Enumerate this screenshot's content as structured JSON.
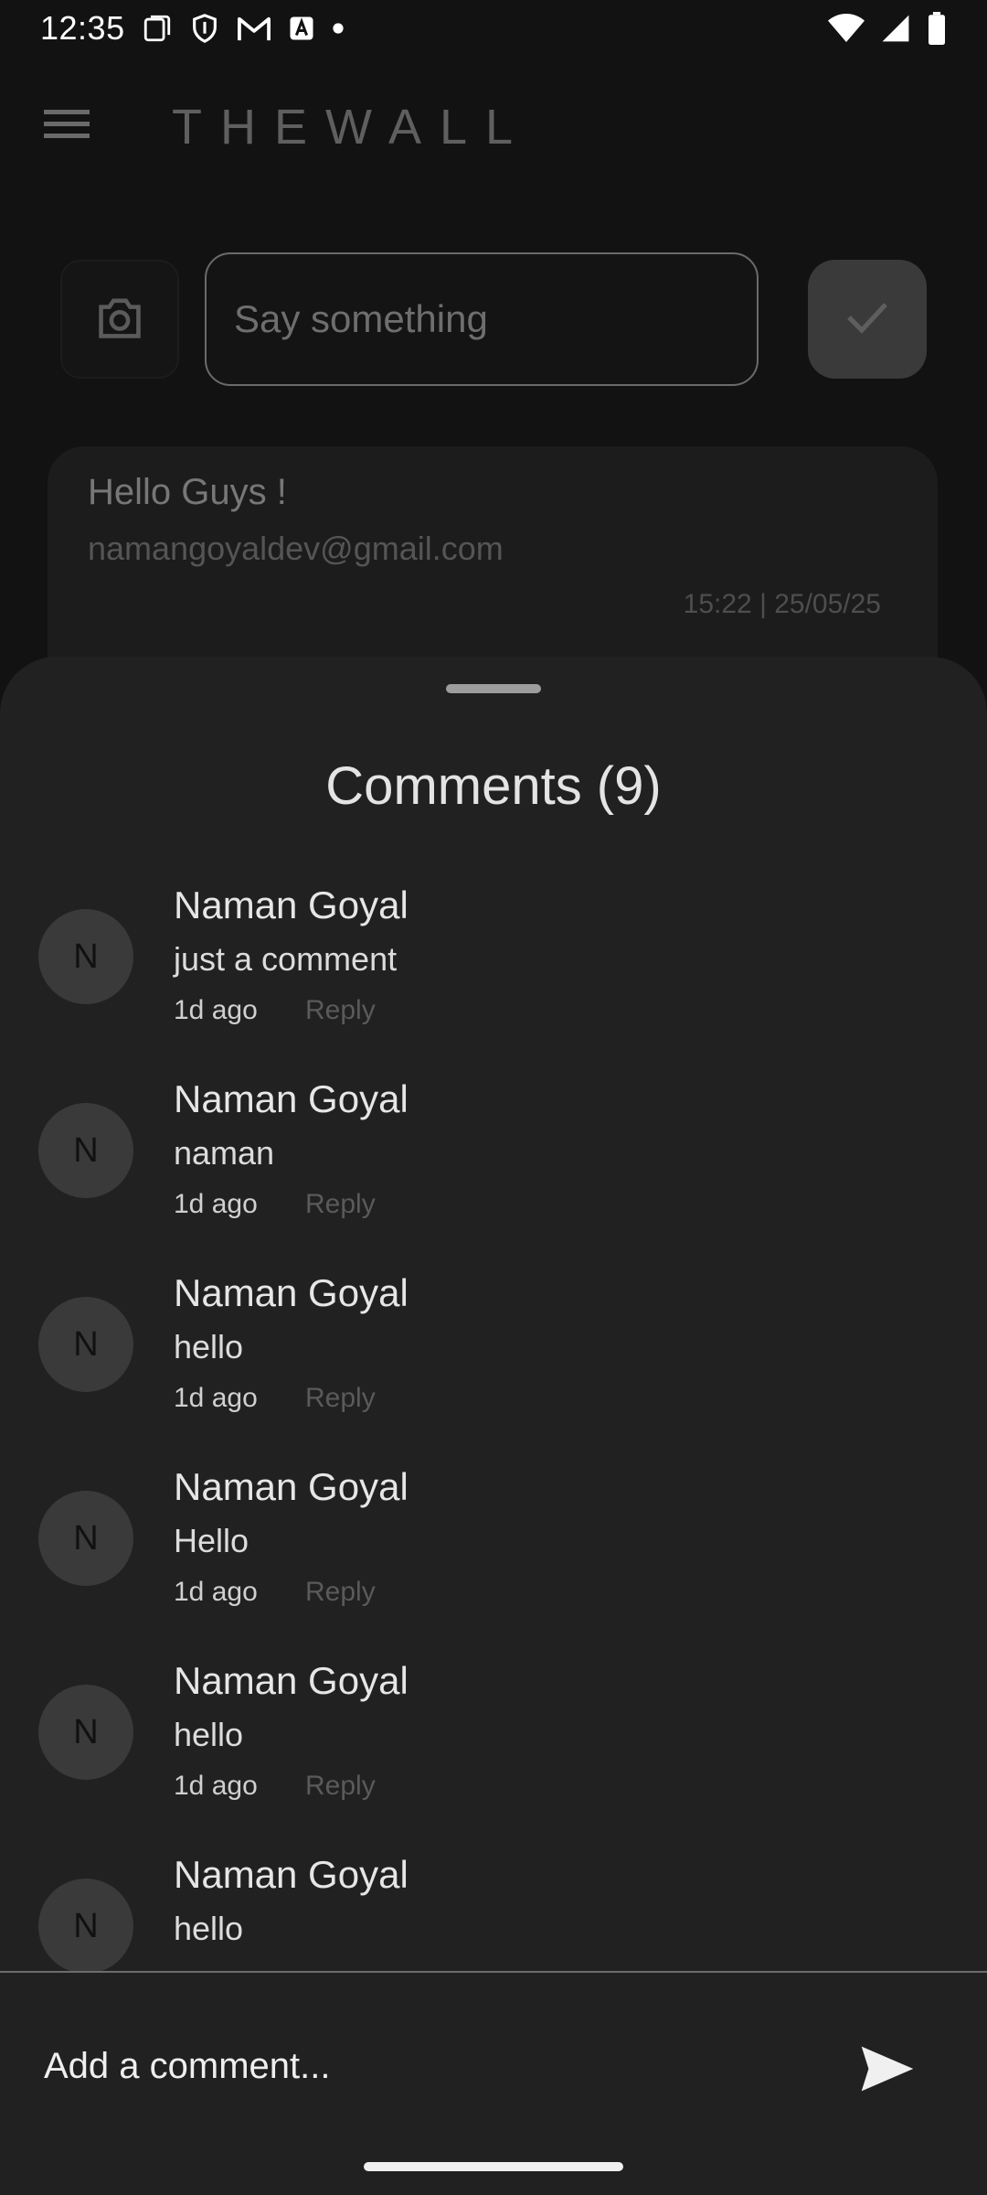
{
  "status_bar": {
    "time": "12:35"
  },
  "app_bar": {
    "title": "THEWALL"
  },
  "composer": {
    "placeholder": "Say something"
  },
  "post": {
    "text": "Hello Guys !",
    "email": "namangoyaldev@gmail.com",
    "time": "15:22 | 25/05/25"
  },
  "sheet": {
    "title": "Comments (9)",
    "comments": [
      {
        "avatar": "N",
        "name": "Naman Goyal",
        "text": "just a comment",
        "time": "1d ago",
        "reply": "Reply"
      },
      {
        "avatar": "N",
        "name": "Naman Goyal",
        "text": "naman",
        "time": "1d ago",
        "reply": "Reply"
      },
      {
        "avatar": "N",
        "name": "Naman Goyal",
        "text": "hello",
        "time": "1d ago",
        "reply": "Reply"
      },
      {
        "avatar": "N",
        "name": "Naman Goyal",
        "text": "Hello",
        "time": "1d ago",
        "reply": "Reply"
      },
      {
        "avatar": "N",
        "name": "Naman Goyal",
        "text": "hello",
        "time": "1d ago",
        "reply": "Reply"
      },
      {
        "avatar": "N",
        "name": "Naman Goyal",
        "text": "hello",
        "time": "",
        "reply": ""
      }
    ],
    "add_comment_placeholder": "Add a comment..."
  },
  "icons": {
    "menu": "menu-icon",
    "camera": "camera-icon",
    "check": "check-icon",
    "send": "send-icon"
  }
}
